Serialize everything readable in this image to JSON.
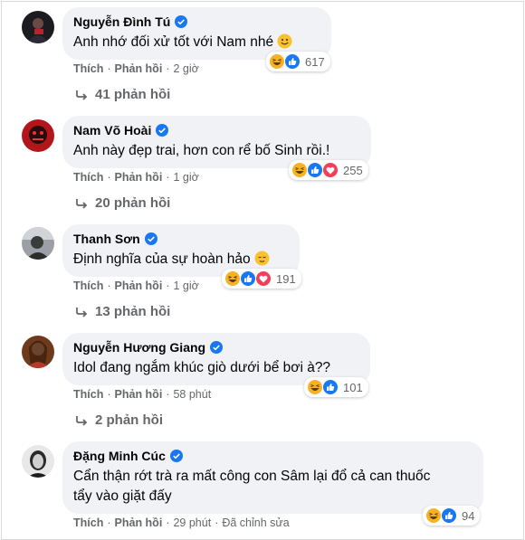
{
  "comments": [
    {
      "name": "Nguyễn Đình Tú",
      "text": "Anh nhớ đối xử tốt với Nam nhé",
      "like": "Thích",
      "reply": "Phản hồi",
      "time": "2 giờ",
      "edited": "",
      "reaction_count": "617",
      "reaction_icons": [
        "haha",
        "like"
      ],
      "reply_count_label": "41 phản hồi",
      "inline_emoji": "smile"
    },
    {
      "name": "Nam Võ Hoài",
      "text": "Anh này đẹp trai, hơn con rể bố Sinh rồi.!",
      "like": "Thích",
      "reply": "Phản hồi",
      "time": "1 giờ",
      "edited": "",
      "reaction_count": "255",
      "reaction_icons": [
        "haha",
        "like",
        "love"
      ],
      "reply_count_label": "20 phản hồi",
      "inline_emoji": ""
    },
    {
      "name": "Thanh Sơn",
      "text": "Định nghĩa của sự hoàn hảo",
      "like": "Thích",
      "reply": "Phản hồi",
      "time": "1 giờ",
      "edited": "",
      "reaction_count": "191",
      "reaction_icons": [
        "haha",
        "like",
        "love"
      ],
      "reply_count_label": "13 phản hồi",
      "inline_emoji": "relieved"
    },
    {
      "name": "Nguyễn Hương Giang",
      "text": "Idol đang ngắm khúc giò dưới bể bơi à??",
      "like": "Thích",
      "reply": "Phản hồi",
      "time": "58 phút",
      "edited": "",
      "reaction_count": "101",
      "reaction_icons": [
        "haha",
        "like"
      ],
      "reply_count_label": "2 phản hồi",
      "inline_emoji": ""
    },
    {
      "name": "Đặng Minh Cúc",
      "text_line1": "Cẩn thận rớt trà ra mất công con Sâm lại đổ cả can thuốc",
      "text_line2": "tẩy vào giặt đấy",
      "like": "Thích",
      "reply": "Phản hồi",
      "time": "29 phút",
      "edited": "Đã chỉnh sửa",
      "reaction_count": "94",
      "reaction_icons": [
        "haha",
        "like"
      ],
      "reply_count_label": "",
      "inline_emoji": ""
    }
  ],
  "separator": "·",
  "colors": {
    "like_blue": "#1877f2",
    "love_red": "#f33e58",
    "haha_yellow": "#f7b125",
    "bubble": "#f0f2f5",
    "meta": "#65676b"
  }
}
